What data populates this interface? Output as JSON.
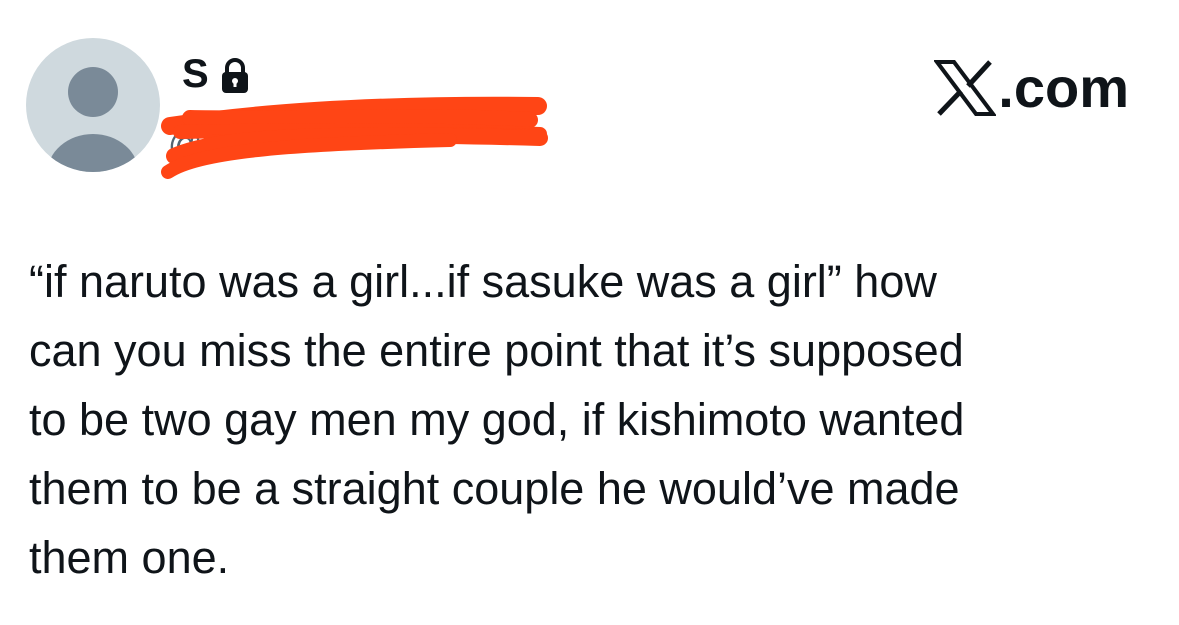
{
  "author": {
    "display_name": "S",
    "handle": "@",
    "avatar_icon": "default-avatar-icon",
    "protected_icon": "lock-icon"
  },
  "brand": {
    "logo_icon": "x-logo-icon",
    "suffix": ".com"
  },
  "tweet": {
    "text": "“if naruto was a girl...if sasuke was a girl” how\ncan you miss the entire point that it’s supposed\nto be two gay men my god, if kishimoto wanted\nthem to be a straight couple he would’ve made\nthem one."
  },
  "colors": {
    "text": "#0f1419",
    "secondary_text": "#536471",
    "avatar_bg": "#cfd9de",
    "avatar_figure": "#7a8a98",
    "redaction": "#ff4515"
  }
}
